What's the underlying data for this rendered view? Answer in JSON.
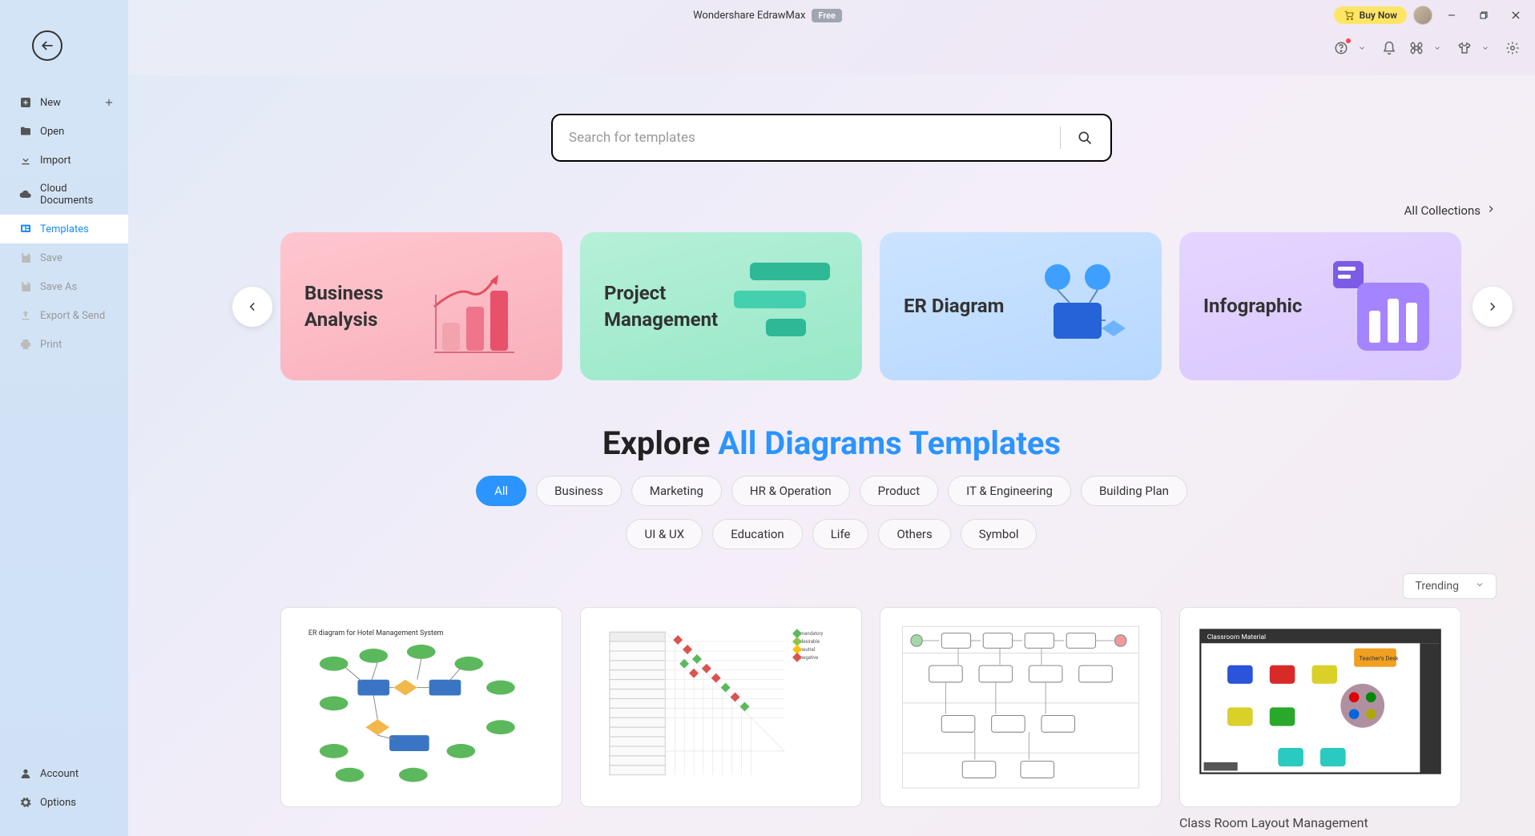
{
  "titlebar": {
    "app_name": "Wondershare EdrawMax",
    "badge": "Free",
    "buy_now": "Buy Now"
  },
  "sidebar": {
    "items": [
      {
        "label": "New",
        "icon": "plus-square-icon"
      },
      {
        "label": "Open",
        "icon": "folder-icon"
      },
      {
        "label": "Import",
        "icon": "download-icon"
      },
      {
        "label": "Cloud Documents",
        "icon": "cloud-icon"
      },
      {
        "label": "Templates",
        "icon": "templates-icon"
      },
      {
        "label": "Save",
        "icon": "save-icon"
      },
      {
        "label": "Save As",
        "icon": "save-as-icon"
      },
      {
        "label": "Export & Send",
        "icon": "export-icon"
      },
      {
        "label": "Print",
        "icon": "print-icon"
      }
    ],
    "bottom": [
      {
        "label": "Account",
        "icon": "user-icon"
      },
      {
        "label": "Options",
        "icon": "gear-icon"
      }
    ]
  },
  "search": {
    "placeholder": "Search for templates"
  },
  "collections_link": "All Collections",
  "carousel": {
    "cards": [
      {
        "title": "Business Analysis"
      },
      {
        "title": "Project Management"
      },
      {
        "title": "ER Diagram"
      },
      {
        "title": "Infographic"
      }
    ]
  },
  "explore": {
    "prefix": "Explore ",
    "highlight": "All Diagrams Templates"
  },
  "filters": {
    "row1": [
      "All",
      "Business",
      "Marketing",
      "HR & Operation",
      "Product",
      "IT & Engineering",
      "Building Plan"
    ],
    "row2": [
      "UI & UX",
      "Education",
      "Life",
      "Others",
      "Symbol"
    ]
  },
  "sort": {
    "selected": "Trending"
  },
  "templates": [
    {
      "name": "ER diagram for Hotel Management System"
    },
    {
      "name": ""
    },
    {
      "name": ""
    },
    {
      "name": "Class Room Layout Management"
    }
  ]
}
